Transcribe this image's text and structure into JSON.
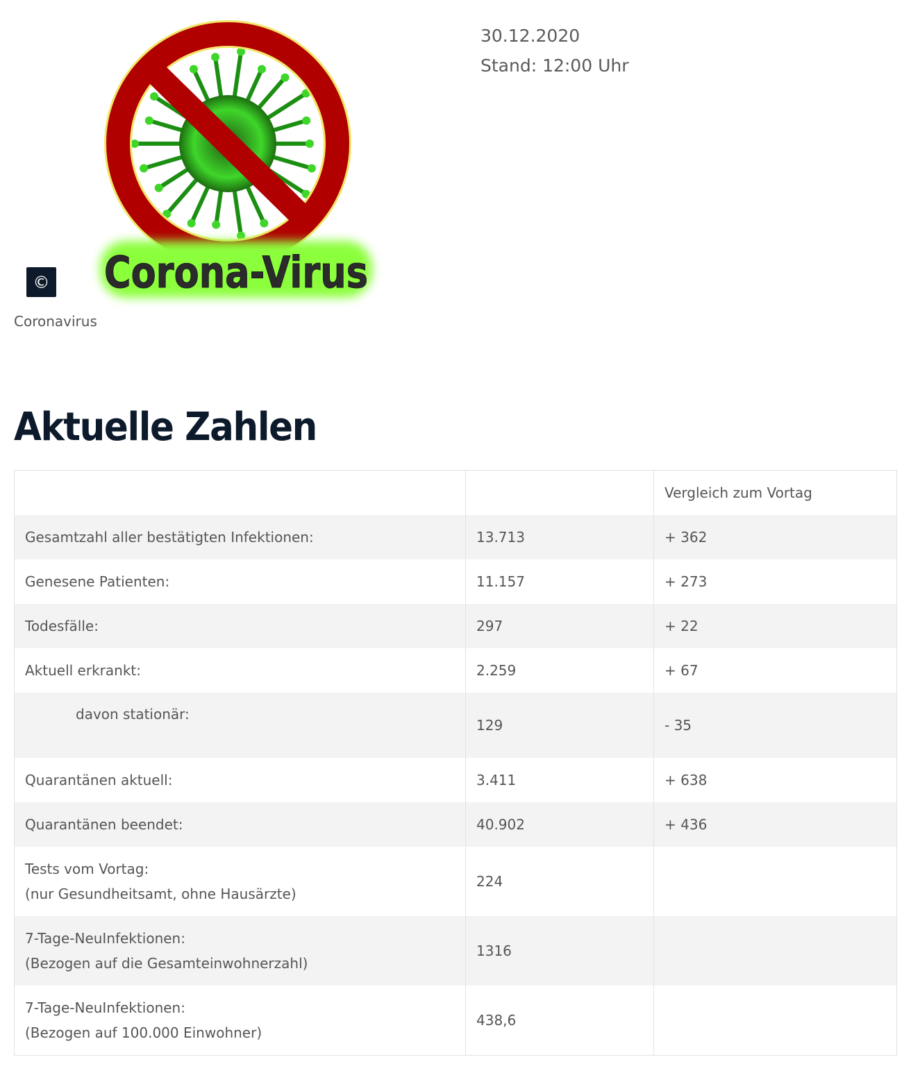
{
  "header": {
    "date": "30.12.2020",
    "stand": "Stand: 12:00 Uhr"
  },
  "image": {
    "logo_text": "Corona-Virus",
    "copyright_symbol": "©",
    "caption": "Coronavirus",
    "colors": {
      "ring": "#b10000",
      "virus": "#3fd62a",
      "glow": "#8cff3c",
      "text": "#2b2b2b"
    }
  },
  "section": {
    "title": "Aktuelle Zahlen"
  },
  "table": {
    "header": [
      "",
      "",
      "Vergleich zum Vortag"
    ],
    "rows": [
      {
        "label": "Gesamtzahl aller bestätigten Infektionen:",
        "value": "13.713",
        "change": "+ 362"
      },
      {
        "label": "Genesene Patienten:",
        "value": "11.157",
        "change": "+ 273"
      },
      {
        "label": "Todesfälle:",
        "value": "297",
        "change": "+ 22"
      },
      {
        "label": "Aktuell erkrankt:",
        "value": "2.259",
        "change": "+ 67"
      },
      {
        "label": "davon stationär:",
        "value": "129",
        "change": "- 35"
      },
      {
        "label": "Quarantänen aktuell:",
        "value": "3.411",
        "change": "+ 638"
      },
      {
        "label": "Quarantänen beendet:",
        "value": "40.902",
        "change": "+ 436"
      },
      {
        "label": "Tests vom Vortag:",
        "label2": "(nur Gesundheitsamt, ohne Hausärzte)",
        "value": "224",
        "change": ""
      },
      {
        "label": "7-Tage-NeuInfektionen:",
        "label2": "(Bezogen auf die Gesamteinwohnerzahl)",
        "value": "1316",
        "change": ""
      },
      {
        "label": "7-Tage-NeuInfektionen:",
        "label2": "(Bezogen auf 100.000 Einwohner)",
        "value": "438,6",
        "change": ""
      }
    ]
  }
}
